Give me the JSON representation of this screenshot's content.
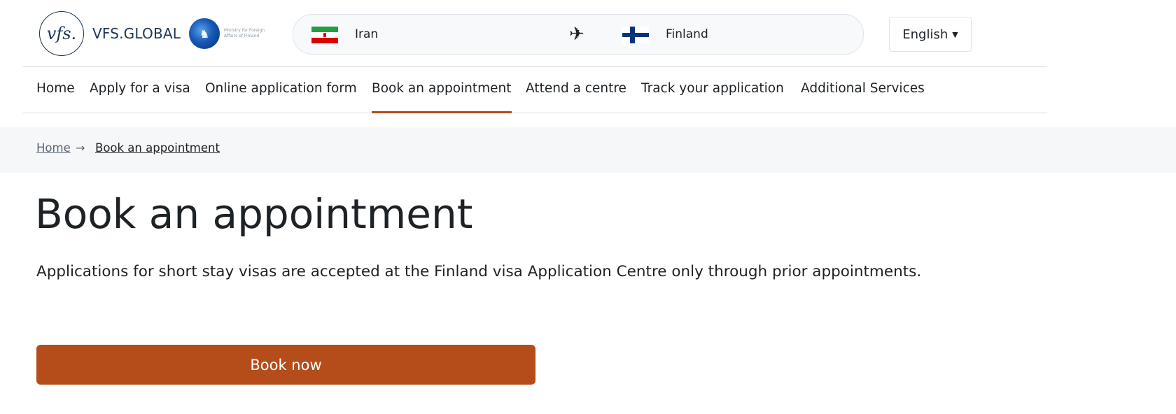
{
  "brand": {
    "logo_mark": "vfs.",
    "name": "VFS.GLOBAL",
    "partner_text": "Ministry for Foreign Affairs of Finland"
  },
  "route": {
    "from_country": "Iran",
    "from_flag_icon": "iran-flag-icon",
    "plane_icon": "plane-icon",
    "to_country": "Finland",
    "to_flag_icon": "finland-flag-icon"
  },
  "language": {
    "selected": "English",
    "caret_icon": "caret-down-icon"
  },
  "nav": {
    "items": [
      {
        "label": "Home"
      },
      {
        "label": "Apply for a visa"
      },
      {
        "label": "Online application form"
      },
      {
        "label": "Book an appointment",
        "active": true
      },
      {
        "label": "Attend a centre"
      },
      {
        "label": "Track your application"
      },
      {
        "label": "Additional Services"
      }
    ]
  },
  "breadcrumb": {
    "home": "Home",
    "separator": "→",
    "current": "Book an appointment"
  },
  "main": {
    "title": "Book an appointment",
    "lead": "Applications for short stay visas are accepted at the Finland visa Application Centre only through prior appointments.",
    "book_button": "Book now"
  },
  "colors": {
    "accent": "#b44d1a",
    "text": "#1d2226",
    "brand_navy": "#1d3557",
    "crumb_bg": "#f6f7f9"
  }
}
